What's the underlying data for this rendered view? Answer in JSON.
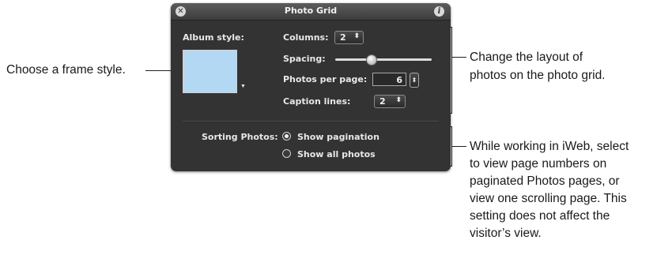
{
  "window": {
    "title": "Photo Grid"
  },
  "album": {
    "label": "Album style:"
  },
  "columns": {
    "label": "Columns:",
    "value": "2"
  },
  "spacing": {
    "label": "Spacing:",
    "level_fraction": 0.38
  },
  "photos_per_page": {
    "label": "Photos per page:",
    "value": "6"
  },
  "caption_lines": {
    "label": "Caption lines:",
    "value": "2"
  },
  "sorting": {
    "label": "Sorting Photos:",
    "options": [
      {
        "label": "Show pagination",
        "selected": true
      },
      {
        "label": "Show all photos",
        "selected": false
      }
    ]
  },
  "callouts": {
    "frame": "Choose a frame style.",
    "layout": [
      "Change the layout of",
      "photos on the photo grid."
    ],
    "sorting": [
      "While working in iWeb, select",
      "to view page numbers on",
      "paginated Photos pages, or",
      "view one scrolling page. This",
      "setting does not affect the",
      "visitor’s view."
    ]
  },
  "colors": {
    "panel_bg": "#333333",
    "swatch": "#b3d8f4",
    "text_light": "#e8e8e8"
  },
  "icons": {
    "close": "close-icon",
    "info": "info-icon",
    "popup_arrows": "updown-arrows-icon",
    "swatch_menu": "triangle-down-icon"
  }
}
